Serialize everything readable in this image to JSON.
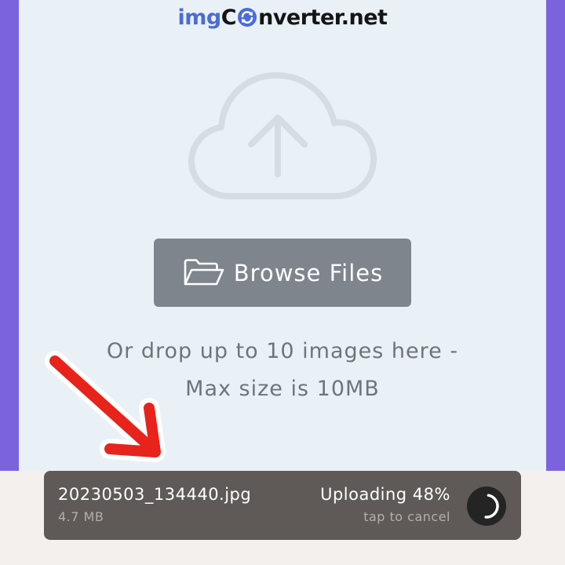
{
  "logo": {
    "part1": "img",
    "part2": "C",
    "part3": "nverter.net"
  },
  "upload": {
    "button_label": "Browse Files",
    "drop_line1": "Or drop up to 10 images here -",
    "drop_line2": "Max size is 10MB"
  },
  "file": {
    "name": "20230503_134440.jpg",
    "size": "4.7 MB",
    "status": "Uploading 48%",
    "progress_percent": 48,
    "cancel_hint": "tap to cancel"
  },
  "colors": {
    "background": "#7b63de",
    "card": "#e9f1f7",
    "button": "#7f858c",
    "upload_bar": "#5f5a57",
    "logo_accent": "#4b6bd9",
    "annotation_arrow": "#e8231b"
  },
  "icons": {
    "upload": "cloud-upload-icon",
    "folder": "folder-open-icon",
    "spinner": "loading-spinner-icon",
    "annotation": "red-arrow-icon"
  }
}
